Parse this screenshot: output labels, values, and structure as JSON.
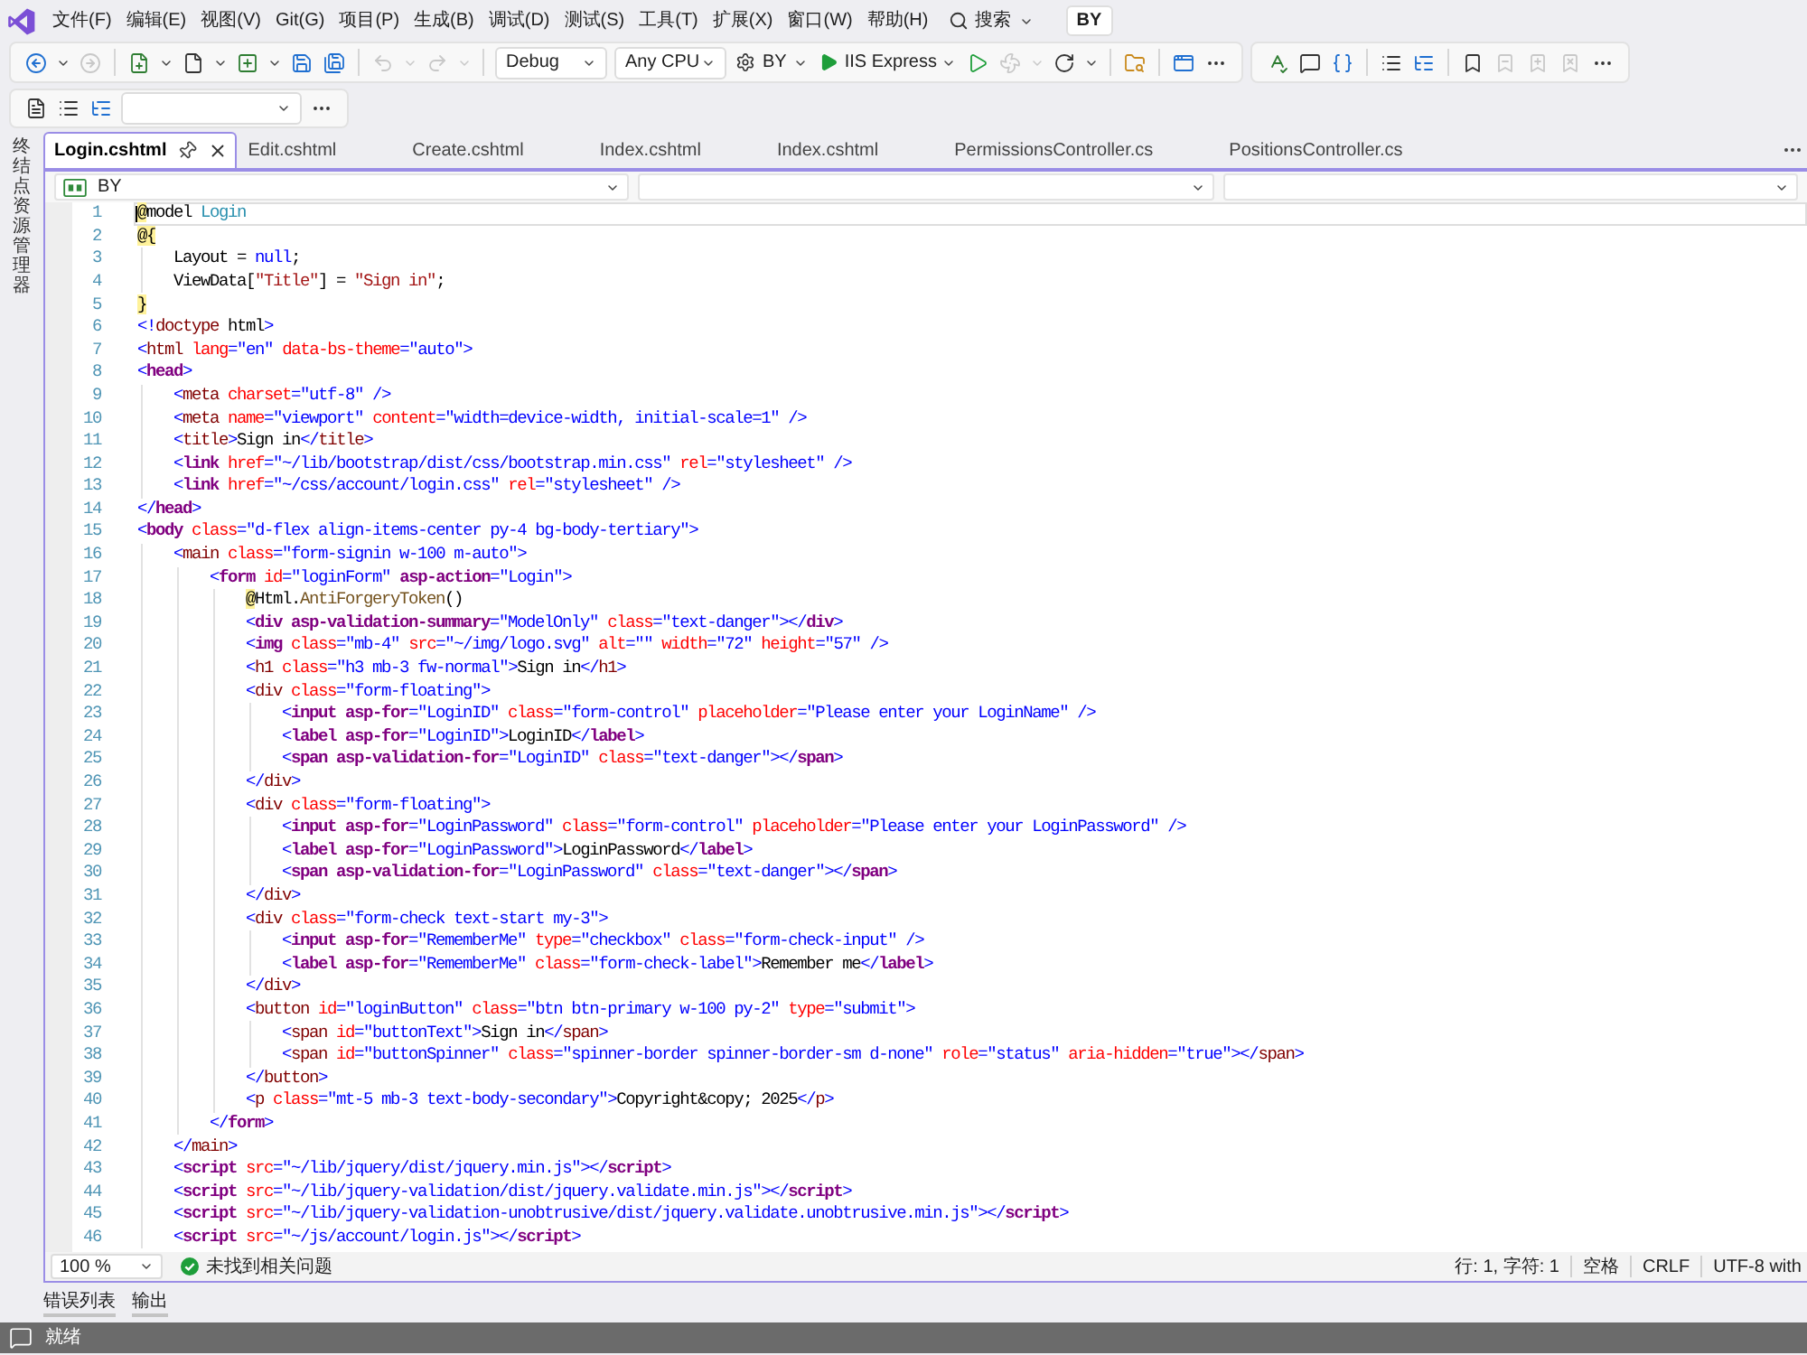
{
  "menu_bar": {
    "items": [
      "文件(F)",
      "编辑(E)",
      "视图(V)",
      "Git(G)",
      "项目(P)",
      "生成(B)",
      "调试(D)",
      "测试(S)",
      "工具(T)",
      "扩展(X)",
      "窗口(W)",
      "帮助(H)"
    ],
    "search": "搜索",
    "account": "BY"
  },
  "toolbars": [
    {
      "panels": [
        [
          {
            "kind": "back",
            "disabled": false
          },
          {
            "kind": "menu-arrow",
            "disabled": false
          },
          {
            "kind": "forward",
            "disabled": true
          },
          {
            "kind": "separator"
          },
          {
            "kind": "new-project",
            "disabled": false
          },
          {
            "kind": "menu-arrow",
            "disabled": false
          },
          {
            "kind": "new-file",
            "disabled": false
          },
          {
            "kind": "menu-arrow",
            "disabled": false
          },
          {
            "kind": "add-item",
            "disabled": false
          },
          {
            "kind": "menu-arrow",
            "disabled": false
          },
          {
            "kind": "save",
            "disabled": false
          },
          {
            "kind": "save-all",
            "disabled": false
          },
          {
            "kind": "separator"
          },
          {
            "kind": "undo",
            "disabled": true
          },
          {
            "kind": "menu-arrow",
            "disabled": true
          },
          {
            "kind": "redo",
            "disabled": true
          },
          {
            "kind": "menu-arrow",
            "disabled": true
          },
          {
            "kind": "separator"
          },
          {
            "kind": "combo",
            "value": "Debug"
          },
          {
            "kind": "combo",
            "value": "Any CPU"
          },
          {
            "kind": "project",
            "value": "BY"
          },
          {
            "kind": "run",
            "value": "IIS Express"
          },
          {
            "kind": "start",
            "disabled": false
          },
          {
            "kind": "attach",
            "disabled": true
          },
          {
            "kind": "menu-arrow",
            "disabled": true
          },
          {
            "kind": "restart",
            "disabled": false
          },
          {
            "kind": "menu-arrow",
            "disabled": false
          },
          {
            "kind": "separator"
          },
          {
            "kind": "find-in-files",
            "disabled": false
          },
          {
            "kind": "separator"
          },
          {
            "kind": "browser",
            "disabled": false
          },
          {
            "kind": "more",
            "disabled": false
          }
        ],
        [
          {
            "kind": "spellcheck",
            "disabled": false
          },
          {
            "kind": "comment",
            "disabled": false
          },
          {
            "kind": "format",
            "disabled": false
          },
          {
            "kind": "separator"
          },
          {
            "kind": "outdent",
            "disabled": false
          },
          {
            "kind": "indent",
            "disabled": false
          },
          {
            "kind": "separator"
          },
          {
            "kind": "bookmark",
            "disabled": false
          },
          {
            "kind": "bookmark-previous",
            "disabled": true
          },
          {
            "kind": "bookmark-next",
            "disabled": true
          },
          {
            "kind": "bookmark-clear",
            "disabled": true
          },
          {
            "kind": "more",
            "disabled": false
          }
        ]
      ]
    },
    {
      "panels": [
        [
          {
            "kind": "document",
            "disabled": false
          },
          {
            "kind": "outdent",
            "disabled": false
          },
          {
            "kind": "indent",
            "disabled": false
          },
          {
            "kind": "combo"
          },
          {
            "kind": "more",
            "disabled": false
          }
        ]
      ]
    }
  ],
  "side_panel": {
    "label": "终结点资源管理器"
  },
  "tabs": [
    {
      "label": "Login.cshtml",
      "selected": true
    },
    {
      "label": "Edit.cshtml",
      "selected": false
    },
    {
      "label": "Create.cshtml",
      "selected": false
    },
    {
      "label": "Index.cshtml",
      "selected": false
    },
    {
      "label": "Index.cshtml",
      "selected": false
    },
    {
      "label": "PermissionsController.cs",
      "selected": false
    },
    {
      "label": "PositionsController.cs",
      "selected": false
    }
  ],
  "navigation_bar": {
    "project": "BY"
  },
  "editor": {
    "lines": [
      {
        "number": "1",
        "current": true,
        "tokens": [
          {
            "kind": "razor",
            "text": "@"
          },
          {
            "kind": "text",
            "text": "model "
          },
          {
            "kind": "type",
            "text": "Login"
          }
        ]
      },
      {
        "number": "2",
        "current": false,
        "tokens": [
          {
            "kind": "razor",
            "text": "@{"
          }
        ]
      },
      {
        "number": "3",
        "current": false,
        "tokens": [
          {
            "kind": "text",
            "text": "    Layout = "
          },
          {
            "kind": "keyword",
            "text": "null"
          },
          {
            "kind": "text",
            "text": ";"
          }
        ]
      },
      {
        "number": "4",
        "current": false,
        "tokens": [
          {
            "kind": "text",
            "text": "    ViewData["
          },
          {
            "kind": "string",
            "text": "\"Title\""
          },
          {
            "kind": "text",
            "text": "] = "
          },
          {
            "kind": "string",
            "text": "\"Sign in\""
          },
          {
            "kind": "text",
            "text": ";"
          }
        ]
      },
      {
        "number": "5",
        "current": false,
        "tokens": [
          {
            "kind": "razor",
            "text": "}"
          }
        ]
      },
      {
        "number": "6",
        "current": false,
        "tokens": [
          {
            "kind": "markup",
            "text": "<!"
          },
          {
            "kind": "element",
            "text": "doctype"
          },
          {
            "kind": "text",
            "text": " html"
          },
          {
            "kind": "markup",
            "text": ">"
          }
        ]
      },
      {
        "number": "7",
        "current": false,
        "tokens": [
          {
            "kind": "markup",
            "text": "<"
          },
          {
            "kind": "element",
            "text": "html"
          },
          {
            "kind": "attribute",
            "text": " lang"
          },
          {
            "kind": "markup",
            "text": "=\"en\""
          },
          {
            "kind": "attribute",
            "text": " data-bs-theme"
          },
          {
            "kind": "markup",
            "text": "=\"auto\">"
          }
        ]
      },
      {
        "number": "8",
        "current": false,
        "tokens": [
          {
            "kind": "markup",
            "text": "<"
          },
          {
            "kind": "helper",
            "text": "head"
          },
          {
            "kind": "markup",
            "text": ">"
          }
        ]
      },
      {
        "number": "9",
        "current": false,
        "tokens": [
          {
            "kind": "markup",
            "text": "    <"
          },
          {
            "kind": "element",
            "text": "meta"
          },
          {
            "kind": "attribute",
            "text": " charset"
          },
          {
            "kind": "markup",
            "text": "=\"utf-8\" />"
          }
        ]
      },
      {
        "number": "10",
        "current": false,
        "tokens": [
          {
            "kind": "markup",
            "text": "    <"
          },
          {
            "kind": "element",
            "text": "meta"
          },
          {
            "kind": "attribute",
            "text": " name"
          },
          {
            "kind": "markup",
            "text": "=\"viewport\""
          },
          {
            "kind": "attribute",
            "text": " content"
          },
          {
            "kind": "markup",
            "text": "=\"width=device-width, initial-scale=1\" />"
          }
        ]
      },
      {
        "number": "11",
        "current": false,
        "tokens": [
          {
            "kind": "markup",
            "text": "    <"
          },
          {
            "kind": "element",
            "text": "title"
          },
          {
            "kind": "markup",
            "text": ">"
          },
          {
            "kind": "text",
            "text": "Sign in"
          },
          {
            "kind": "markup",
            "text": "</"
          },
          {
            "kind": "element",
            "text": "title"
          },
          {
            "kind": "markup",
            "text": ">"
          }
        ]
      },
      {
        "number": "12",
        "current": false,
        "tokens": [
          {
            "kind": "markup",
            "text": "    <"
          },
          {
            "kind": "helper",
            "text": "link"
          },
          {
            "kind": "attribute",
            "text": " href"
          },
          {
            "kind": "markup",
            "text": "=\"~/lib/bootstrap/dist/css/bootstrap.min.css\""
          },
          {
            "kind": "attribute",
            "text": " rel"
          },
          {
            "kind": "markup",
            "text": "=\"stylesheet\" />"
          }
        ]
      },
      {
        "number": "13",
        "current": false,
        "tokens": [
          {
            "kind": "markup",
            "text": "    <"
          },
          {
            "kind": "helper",
            "text": "link"
          },
          {
            "kind": "attribute",
            "text": " href"
          },
          {
            "kind": "markup",
            "text": "=\"~/css/account/login.css\""
          },
          {
            "kind": "attribute",
            "text": " rel"
          },
          {
            "kind": "markup",
            "text": "=\"stylesheet\" />"
          }
        ]
      },
      {
        "number": "14",
        "current": false,
        "tokens": [
          {
            "kind": "markup",
            "text": "</"
          },
          {
            "kind": "helper",
            "text": "head"
          },
          {
            "kind": "markup",
            "text": ">"
          }
        ]
      },
      {
        "number": "15",
        "current": false,
        "tokens": [
          {
            "kind": "markup",
            "text": "<"
          },
          {
            "kind": "helper",
            "text": "body"
          },
          {
            "kind": "attribute",
            "text": " class"
          },
          {
            "kind": "markup",
            "text": "=\"d-flex align-items-center py-4 bg-body-tertiary\">"
          }
        ]
      },
      {
        "number": "16",
        "current": false,
        "tokens": [
          {
            "kind": "markup",
            "text": "    <"
          },
          {
            "kind": "element",
            "text": "main"
          },
          {
            "kind": "attribute",
            "text": " class"
          },
          {
            "kind": "markup",
            "text": "=\"form-signin w-100 m-auto\">"
          }
        ]
      },
      {
        "number": "17",
        "current": false,
        "tokens": [
          {
            "kind": "markup",
            "text": "        <"
          },
          {
            "kind": "helper",
            "text": "form"
          },
          {
            "kind": "attribute",
            "text": " id"
          },
          {
            "kind": "markup",
            "text": "=\"loginForm\""
          },
          {
            "kind": "helper",
            "text": " asp-action"
          },
          {
            "kind": "markup",
            "text": "=\"Login\">"
          }
        ]
      },
      {
        "number": "18",
        "current": false,
        "tokens": [
          {
            "kind": "razor",
            "text": "            @"
          },
          {
            "kind": "text",
            "text": "Html."
          },
          {
            "kind": "method",
            "text": "AntiForgeryToken"
          },
          {
            "kind": "text",
            "text": "()"
          }
        ]
      },
      {
        "number": "19",
        "current": false,
        "tokens": [
          {
            "kind": "markup",
            "text": "            <"
          },
          {
            "kind": "helper",
            "text": "div asp-validation-summary"
          },
          {
            "kind": "markup",
            "text": "=\"ModelOnly\""
          },
          {
            "kind": "attribute",
            "text": " class"
          },
          {
            "kind": "markup",
            "text": "=\"text-danger\"></"
          },
          {
            "kind": "helper",
            "text": "div"
          },
          {
            "kind": "markup",
            "text": ">"
          }
        ]
      },
      {
        "number": "20",
        "current": false,
        "tokens": [
          {
            "kind": "markup",
            "text": "            <"
          },
          {
            "kind": "helper",
            "text": "img"
          },
          {
            "kind": "attribute",
            "text": " class"
          },
          {
            "kind": "markup",
            "text": "=\"mb-4\""
          },
          {
            "kind": "attribute",
            "text": " src"
          },
          {
            "kind": "markup",
            "text": "=\"~/img/logo.svg\""
          },
          {
            "kind": "attribute",
            "text": " alt"
          },
          {
            "kind": "markup",
            "text": "=\"\""
          },
          {
            "kind": "attribute",
            "text": " width"
          },
          {
            "kind": "markup",
            "text": "=\"72\""
          },
          {
            "kind": "attribute",
            "text": " height"
          },
          {
            "kind": "markup",
            "text": "=\"57\" />"
          }
        ]
      },
      {
        "number": "21",
        "current": false,
        "tokens": [
          {
            "kind": "markup",
            "text": "            <"
          },
          {
            "kind": "element",
            "text": "h1"
          },
          {
            "kind": "attribute",
            "text": " class"
          },
          {
            "kind": "markup",
            "text": "=\"h3 mb-3 fw-normal\">"
          },
          {
            "kind": "text",
            "text": "Sign in"
          },
          {
            "kind": "markup",
            "text": "</"
          },
          {
            "kind": "element",
            "text": "h1"
          },
          {
            "kind": "markup",
            "text": ">"
          }
        ]
      },
      {
        "number": "22",
        "current": false,
        "tokens": [
          {
            "kind": "markup",
            "text": "            <"
          },
          {
            "kind": "element",
            "text": "div"
          },
          {
            "kind": "attribute",
            "text": " class"
          },
          {
            "kind": "markup",
            "text": "=\"form-floating\">"
          }
        ]
      },
      {
        "number": "23",
        "current": false,
        "tokens": [
          {
            "kind": "markup",
            "text": "                <"
          },
          {
            "kind": "helper",
            "text": "input asp-for"
          },
          {
            "kind": "markup",
            "text": "=\"LoginID\""
          },
          {
            "kind": "attribute",
            "text": " class"
          },
          {
            "kind": "markup",
            "text": "=\"form-control\""
          },
          {
            "kind": "attribute",
            "text": " placeholder"
          },
          {
            "kind": "markup",
            "text": "=\"Please enter your LoginName\" />"
          }
        ]
      },
      {
        "number": "24",
        "current": false,
        "tokens": [
          {
            "kind": "markup",
            "text": "                <"
          },
          {
            "kind": "helper",
            "text": "label asp-for"
          },
          {
            "kind": "markup",
            "text": "=\"LoginID\">"
          },
          {
            "kind": "text",
            "text": "LoginID"
          },
          {
            "kind": "markup",
            "text": "</"
          },
          {
            "kind": "helper",
            "text": "label"
          },
          {
            "kind": "markup",
            "text": ">"
          }
        ]
      },
      {
        "number": "25",
        "current": false,
        "tokens": [
          {
            "kind": "markup",
            "text": "                <"
          },
          {
            "kind": "helper",
            "text": "span asp-validation-for"
          },
          {
            "kind": "markup",
            "text": "=\"LoginID\""
          },
          {
            "kind": "attribute",
            "text": " class"
          },
          {
            "kind": "markup",
            "text": "=\"text-danger\"></"
          },
          {
            "kind": "helper",
            "text": "span"
          },
          {
            "kind": "markup",
            "text": ">"
          }
        ]
      },
      {
        "number": "26",
        "current": false,
        "tokens": [
          {
            "kind": "markup",
            "text": "            </"
          },
          {
            "kind": "element",
            "text": "div"
          },
          {
            "kind": "markup",
            "text": ">"
          }
        ]
      },
      {
        "number": "27",
        "current": false,
        "tokens": [
          {
            "kind": "markup",
            "text": "            <"
          },
          {
            "kind": "element",
            "text": "div"
          },
          {
            "kind": "attribute",
            "text": " class"
          },
          {
            "kind": "markup",
            "text": "=\"form-floating\">"
          }
        ]
      },
      {
        "number": "28",
        "current": false,
        "tokens": [
          {
            "kind": "markup",
            "text": "                <"
          },
          {
            "kind": "helper",
            "text": "input asp-for"
          },
          {
            "kind": "markup",
            "text": "=\"LoginPassword\""
          },
          {
            "kind": "attribute",
            "text": " class"
          },
          {
            "kind": "markup",
            "text": "=\"form-control\""
          },
          {
            "kind": "attribute",
            "text": " placeholder"
          },
          {
            "kind": "markup",
            "text": "=\"Please enter your LoginPassword\" />"
          }
        ]
      },
      {
        "number": "29",
        "current": false,
        "tokens": [
          {
            "kind": "markup",
            "text": "                <"
          },
          {
            "kind": "helper",
            "text": "label asp-for"
          },
          {
            "kind": "markup",
            "text": "=\"LoginPassword\">"
          },
          {
            "kind": "text",
            "text": "LoginPassword"
          },
          {
            "kind": "markup",
            "text": "</"
          },
          {
            "kind": "helper",
            "text": "label"
          },
          {
            "kind": "markup",
            "text": ">"
          }
        ]
      },
      {
        "number": "30",
        "current": false,
        "tokens": [
          {
            "kind": "markup",
            "text": "                <"
          },
          {
            "kind": "helper",
            "text": "span asp-validation-for"
          },
          {
            "kind": "markup",
            "text": "=\"LoginPassword\""
          },
          {
            "kind": "attribute",
            "text": " class"
          },
          {
            "kind": "markup",
            "text": "=\"text-danger\"></"
          },
          {
            "kind": "helper",
            "text": "span"
          },
          {
            "kind": "markup",
            "text": ">"
          }
        ]
      },
      {
        "number": "31",
        "current": false,
        "tokens": [
          {
            "kind": "markup",
            "text": "            </"
          },
          {
            "kind": "element",
            "text": "div"
          },
          {
            "kind": "markup",
            "text": ">"
          }
        ]
      },
      {
        "number": "32",
        "current": false,
        "tokens": [
          {
            "kind": "markup",
            "text": "            <"
          },
          {
            "kind": "element",
            "text": "div"
          },
          {
            "kind": "attribute",
            "text": " class"
          },
          {
            "kind": "markup",
            "text": "=\"form-check text-start my-3\">"
          }
        ]
      },
      {
        "number": "33",
        "current": false,
        "tokens": [
          {
            "kind": "markup",
            "text": "                <"
          },
          {
            "kind": "helper",
            "text": "input asp-for"
          },
          {
            "kind": "markup",
            "text": "=\"RememberMe\""
          },
          {
            "kind": "attribute",
            "text": " type"
          },
          {
            "kind": "markup",
            "text": "=\"checkbox\""
          },
          {
            "kind": "attribute",
            "text": " class"
          },
          {
            "kind": "markup",
            "text": "=\"form-check-input\" />"
          }
        ]
      },
      {
        "number": "34",
        "current": false,
        "tokens": [
          {
            "kind": "markup",
            "text": "                <"
          },
          {
            "kind": "helper",
            "text": "label asp-for"
          },
          {
            "kind": "markup",
            "text": "=\"RememberMe\""
          },
          {
            "kind": "attribute",
            "text": " class"
          },
          {
            "kind": "markup",
            "text": "=\"form-check-label\">"
          },
          {
            "kind": "text",
            "text": "Remember me"
          },
          {
            "kind": "markup",
            "text": "</"
          },
          {
            "kind": "helper",
            "text": "label"
          },
          {
            "kind": "markup",
            "text": ">"
          }
        ]
      },
      {
        "number": "35",
        "current": false,
        "tokens": [
          {
            "kind": "markup",
            "text": "            </"
          },
          {
            "kind": "element",
            "text": "div"
          },
          {
            "kind": "markup",
            "text": ">"
          }
        ]
      },
      {
        "number": "36",
        "current": false,
        "tokens": [
          {
            "kind": "markup",
            "text": "            <"
          },
          {
            "kind": "element",
            "text": "button"
          },
          {
            "kind": "attribute",
            "text": " id"
          },
          {
            "kind": "markup",
            "text": "=\"loginButton\""
          },
          {
            "kind": "attribute",
            "text": " class"
          },
          {
            "kind": "markup",
            "text": "=\"btn btn-primary w-100 py-2\""
          },
          {
            "kind": "attribute",
            "text": " type"
          },
          {
            "kind": "markup",
            "text": "=\"submit\">"
          }
        ]
      },
      {
        "number": "37",
        "current": false,
        "tokens": [
          {
            "kind": "markup",
            "text": "                <"
          },
          {
            "kind": "element",
            "text": "span"
          },
          {
            "kind": "attribute",
            "text": " id"
          },
          {
            "kind": "markup",
            "text": "=\"buttonText\">"
          },
          {
            "kind": "text",
            "text": "Sign in"
          },
          {
            "kind": "markup",
            "text": "</"
          },
          {
            "kind": "element",
            "text": "span"
          },
          {
            "kind": "markup",
            "text": ">"
          }
        ]
      },
      {
        "number": "38",
        "current": false,
        "tokens": [
          {
            "kind": "markup",
            "text": "                <"
          },
          {
            "kind": "element",
            "text": "span"
          },
          {
            "kind": "attribute",
            "text": " id"
          },
          {
            "kind": "markup",
            "text": "=\"buttonSpinner\""
          },
          {
            "kind": "attribute",
            "text": " class"
          },
          {
            "kind": "markup",
            "text": "=\"spinner-border spinner-border-sm d-none\""
          },
          {
            "kind": "attribute",
            "text": " role"
          },
          {
            "kind": "markup",
            "text": "=\"status\""
          },
          {
            "kind": "attribute",
            "text": " aria-hidden"
          },
          {
            "kind": "markup",
            "text": "=\"true\"></"
          },
          {
            "kind": "element",
            "text": "span"
          },
          {
            "kind": "markup",
            "text": ">"
          }
        ]
      },
      {
        "number": "39",
        "current": false,
        "tokens": [
          {
            "kind": "markup",
            "text": "            </"
          },
          {
            "kind": "element",
            "text": "button"
          },
          {
            "kind": "markup",
            "text": ">"
          }
        ]
      },
      {
        "number": "40",
        "current": false,
        "tokens": [
          {
            "kind": "markup",
            "text": "            <"
          },
          {
            "kind": "element",
            "text": "p"
          },
          {
            "kind": "attribute",
            "text": " class"
          },
          {
            "kind": "markup",
            "text": "=\"mt-5 mb-3 text-body-secondary\">"
          },
          {
            "kind": "text",
            "text": "Copyright&copy; 2025"
          },
          {
            "kind": "markup",
            "text": "</"
          },
          {
            "kind": "element",
            "text": "p"
          },
          {
            "kind": "markup",
            "text": ">"
          }
        ]
      },
      {
        "number": "41",
        "current": false,
        "tokens": [
          {
            "kind": "markup",
            "text": "        </"
          },
          {
            "kind": "helper",
            "text": "form"
          },
          {
            "kind": "markup",
            "text": ">"
          }
        ]
      },
      {
        "number": "42",
        "current": false,
        "tokens": [
          {
            "kind": "markup",
            "text": "    </"
          },
          {
            "kind": "element",
            "text": "main"
          },
          {
            "kind": "markup",
            "text": ">"
          }
        ]
      },
      {
        "number": "43",
        "current": false,
        "tokens": [
          {
            "kind": "markup",
            "text": "    <"
          },
          {
            "kind": "helper",
            "text": "script"
          },
          {
            "kind": "attribute",
            "text": " src"
          },
          {
            "kind": "markup",
            "text": "=\"~/lib/jquery/dist/jquery.min.js\"></"
          },
          {
            "kind": "helper",
            "text": "script"
          },
          {
            "kind": "markup",
            "text": ">"
          }
        ]
      },
      {
        "number": "44",
        "current": false,
        "tokens": [
          {
            "kind": "markup",
            "text": "    <"
          },
          {
            "kind": "helper",
            "text": "script"
          },
          {
            "kind": "attribute",
            "text": " src"
          },
          {
            "kind": "markup",
            "text": "=\"~/lib/jquery-validation/dist/jquery.validate.min.js\"></"
          },
          {
            "kind": "helper",
            "text": "script"
          },
          {
            "kind": "markup",
            "text": ">"
          }
        ]
      },
      {
        "number": "45",
        "current": false,
        "tokens": [
          {
            "kind": "markup",
            "text": "    <"
          },
          {
            "kind": "helper",
            "text": "script"
          },
          {
            "kind": "attribute",
            "text": " src"
          },
          {
            "kind": "markup",
            "text": "=\"~/lib/jquery-validation-unobtrusive/dist/jquery.validate.unobtrusive.min.js\"></"
          },
          {
            "kind": "helper",
            "text": "script"
          },
          {
            "kind": "markup",
            "text": ">"
          }
        ]
      },
      {
        "number": "46",
        "current": false,
        "tokens": [
          {
            "kind": "markup",
            "text": "    <"
          },
          {
            "kind": "helper",
            "text": "script"
          },
          {
            "kind": "attribute",
            "text": " src"
          },
          {
            "kind": "markup",
            "text": "=\"~/js/account/login.js\"></"
          },
          {
            "kind": "helper",
            "text": "script"
          },
          {
            "kind": "markup",
            "text": ">"
          }
        ]
      }
    ]
  },
  "editor_status": {
    "zoom": "100 %",
    "issues": "未找到相关问题",
    "position": "行: 1, 字符: 1",
    "indentation": "空格",
    "line_ending": "CRLF",
    "encoding": "UTF-8 with"
  },
  "tool_window_tabs": [
    "错误列表",
    "输出"
  ],
  "status_bar": {
    "text": "就绪"
  }
}
